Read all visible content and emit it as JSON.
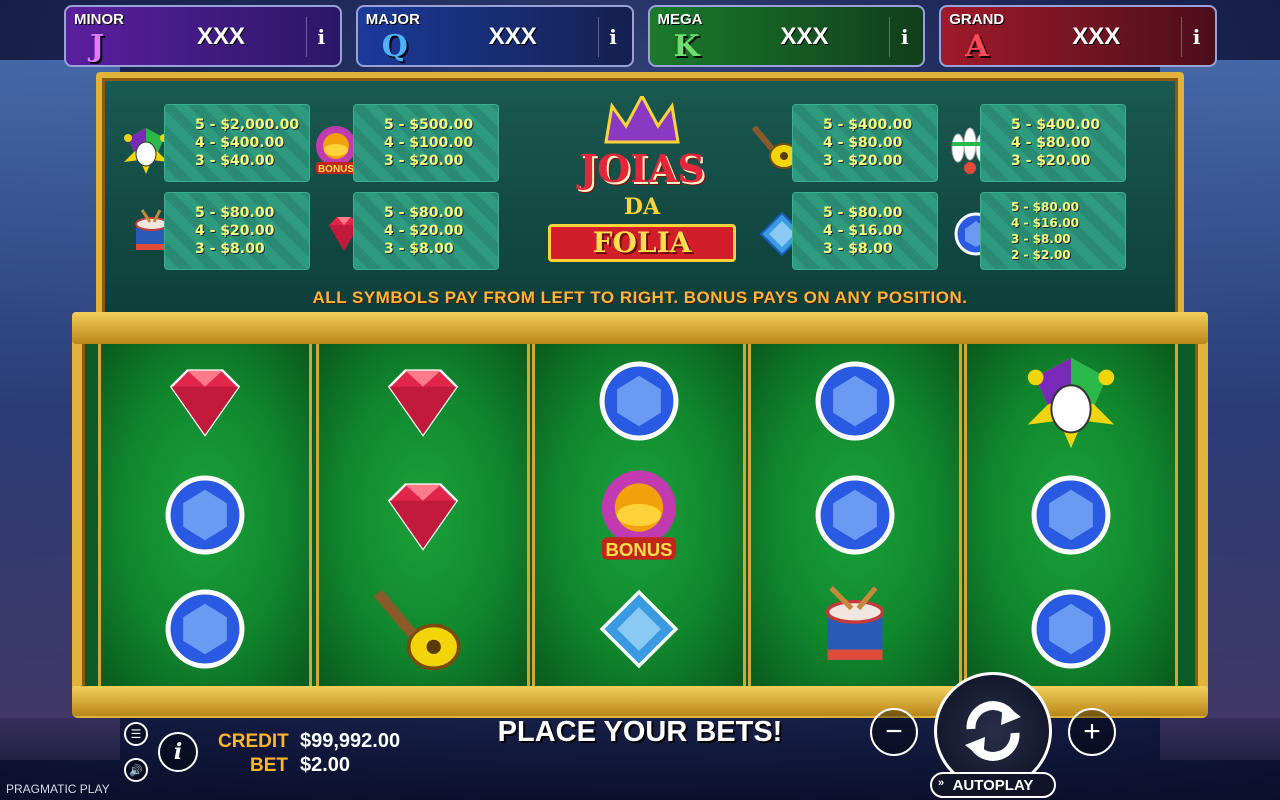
{
  "jackpots": [
    {
      "name": "MINOR",
      "letter": "J",
      "value": "XXX",
      "info": "i"
    },
    {
      "name": "MAJOR",
      "letter": "Q",
      "value": "XXX",
      "info": "i"
    },
    {
      "name": "MEGA",
      "letter": "K",
      "value": "XXX",
      "info": "i"
    },
    {
      "name": "GRAND",
      "letter": "A",
      "value": "XXX",
      "info": "i"
    }
  ],
  "paytable": {
    "jester": [
      "5 - $2,000.00",
      "4 - $400.00",
      "3 - $40.00"
    ],
    "bonus": [
      "5 - $500.00",
      "4 - $100.00",
      "3 - $20.00"
    ],
    "guitar": [
      "5 - $400.00",
      "4 - $80.00",
      "3 - $20.00"
    ],
    "bowling_pins": [
      "5 - $400.00",
      "4 - $80.00",
      "3 - $20.00"
    ],
    "drum": [
      "5 - $80.00",
      "4 - $20.00",
      "3 - $8.00"
    ],
    "red_gem": [
      "5 - $80.00",
      "4 - $20.00",
      "3 - $8.00"
    ],
    "blue_square_gem": [
      "5 - $80.00",
      "4 - $16.00",
      "3 - $8.00"
    ],
    "blue_round_gem": [
      "5 - $80.00",
      "4 - $16.00",
      "3 - $8.00",
      "2 - $2.00"
    ],
    "rule": "ALL SYMBOLS PAY FROM LEFT TO RIGHT. BONUS PAYS ON ANY POSITION."
  },
  "logo": {
    "line1": "JOIAS",
    "line2": "DA",
    "line3": "FOLIA"
  },
  "bonus_label": "BONUS",
  "reels": [
    [
      "red_gem",
      "blue_round_gem",
      "blue_round_gem"
    ],
    [
      "red_gem",
      "red_gem",
      "guitar"
    ],
    [
      "blue_round_gem",
      "bonus",
      "blue_square_gem"
    ],
    [
      "blue_round_gem",
      "blue_round_gem",
      "drum"
    ],
    [
      "jester",
      "blue_round_gem",
      "blue_round_gem"
    ]
  ],
  "controls": {
    "credit_label": "CREDIT",
    "credit_value": "$99,992.00",
    "bet_label": "BET",
    "bet_value": "$2.00",
    "status": "PLACE YOUR BETS!",
    "autoplay": "AUTOPLAY",
    "minus": "−",
    "plus": "+",
    "info": "i",
    "brand": "PRAGMATIC PLAY"
  }
}
